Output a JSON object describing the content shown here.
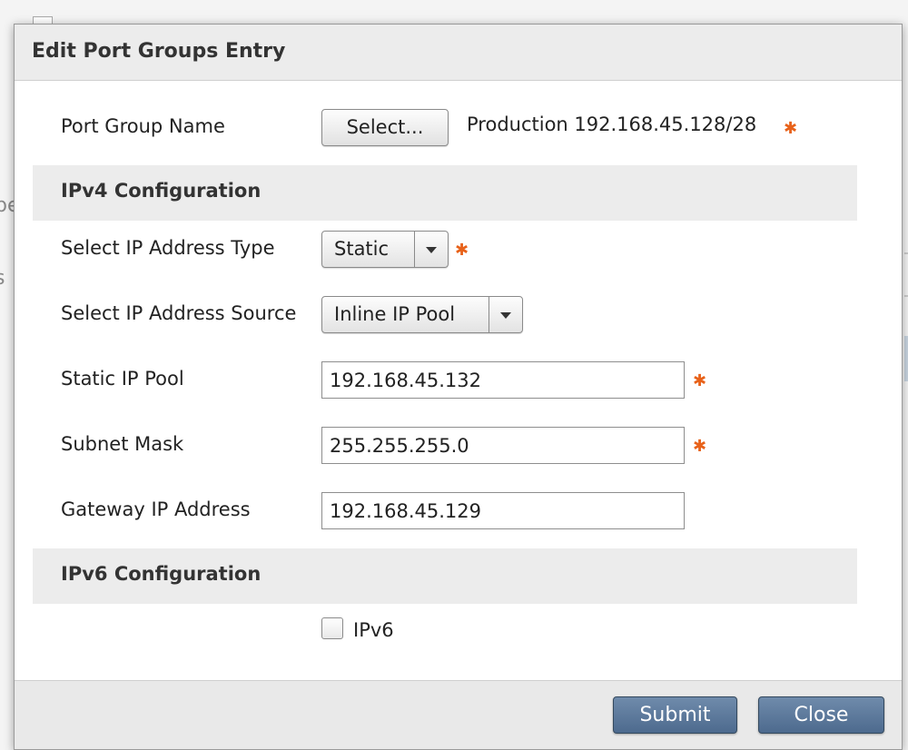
{
  "background": {
    "fragment_1": "pe",
    "fragment_2": "s"
  },
  "dialog": {
    "title": "Edit Port Groups Entry",
    "port_group": {
      "label": "Port Group Name",
      "select_button": "Select...",
      "value": "Production 192.168.45.128/28",
      "required": true
    },
    "ipv4_section": {
      "title": "IPv4 Configuration",
      "address_type": {
        "label": "Select IP Address Type",
        "value": "Static",
        "required": true
      },
      "address_source": {
        "label": "Select IP Address Source",
        "value": "Inline IP Pool"
      },
      "static_ip_pool": {
        "label": "Static IP Pool",
        "value": "192.168.45.132",
        "required": true
      },
      "subnet_mask": {
        "label": "Subnet Mask",
        "value": "255.255.255.0",
        "required": true
      },
      "gateway": {
        "label": "Gateway IP Address",
        "value": "192.168.45.129"
      }
    },
    "ipv6_section": {
      "title": "IPv6 Configuration",
      "checkbox_label": "IPv6",
      "checked": false
    },
    "footer": {
      "submit_label": "Submit",
      "close_label": "Close"
    }
  },
  "icons": {
    "required": "✱",
    "dropdown": "chevron-down-icon"
  },
  "colors": {
    "required_marker": "#e8621a",
    "primary_button": "#5a7698",
    "section_band": "#ececec"
  }
}
